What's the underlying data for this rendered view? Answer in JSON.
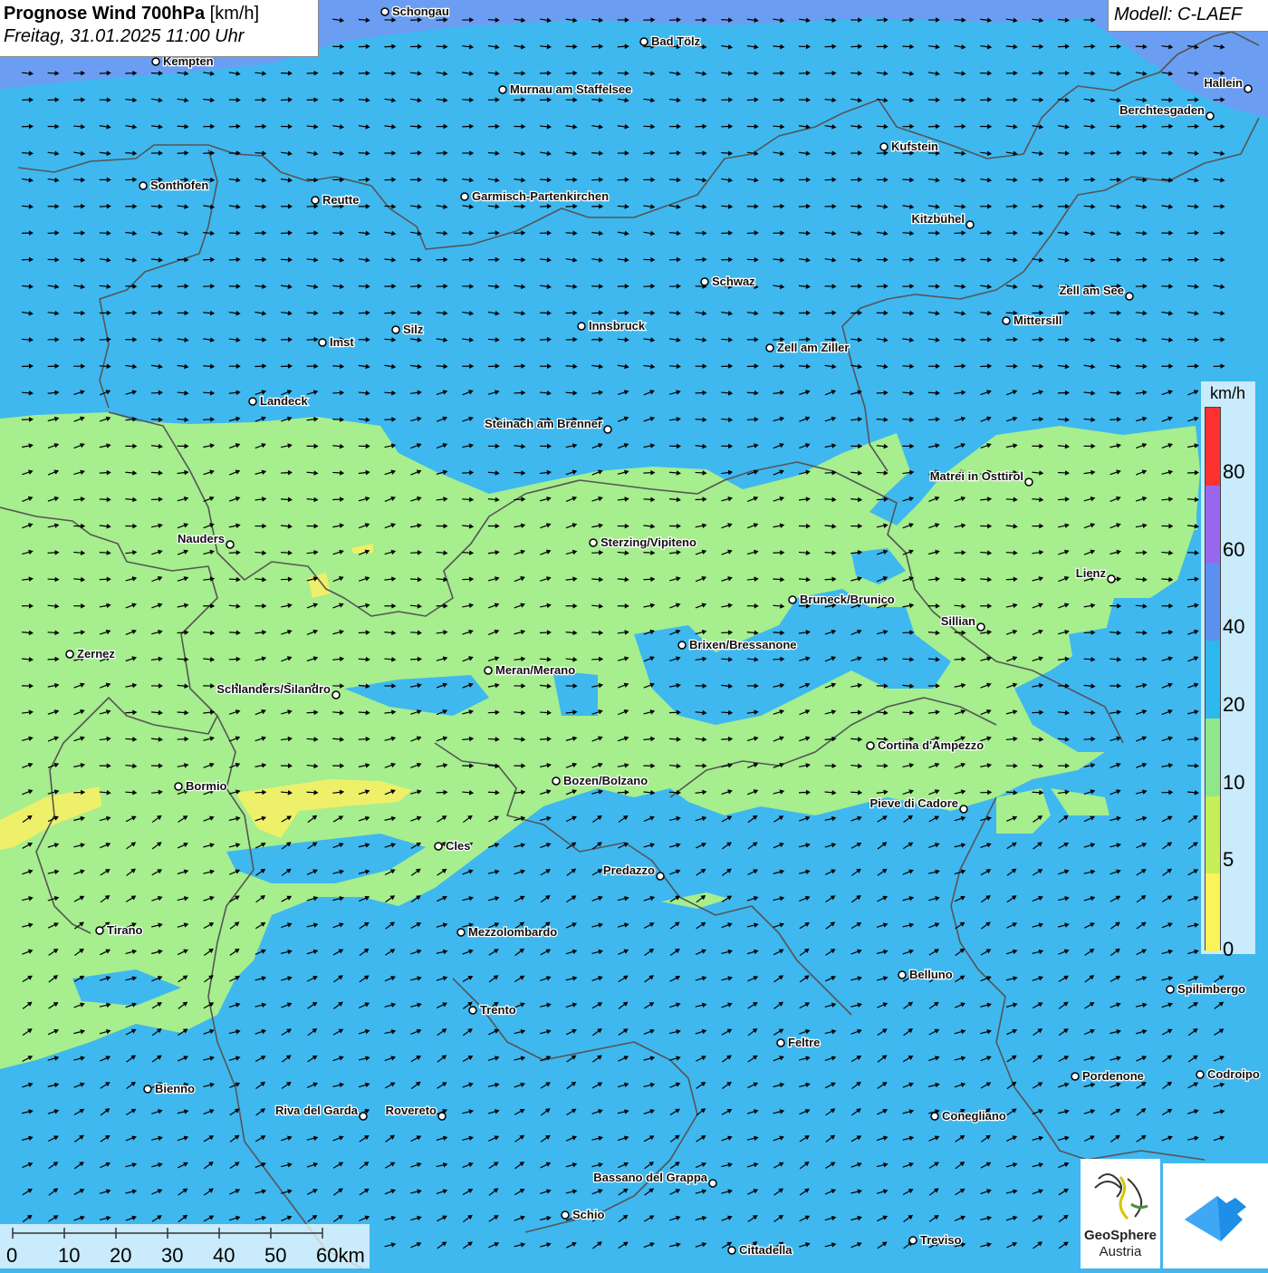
{
  "header": {
    "title_bold": "Prognose Wind 700hPa",
    "title_unit": "[km/h]",
    "datetime": "Freitag, 31.01.2025 11:00 Uhr"
  },
  "model_label": "Modell: C-LAEF",
  "legend": {
    "unit": "km/h",
    "labels": [
      "80",
      "60",
      "40",
      "20",
      "10",
      "5",
      "0"
    ],
    "colors": [
      "#ff3030",
      "#9966ee",
      "#5b8ff0",
      "#2db8ee",
      "#8ee88a",
      "#c6ef5a",
      "#fbf35a"
    ]
  },
  "scale": {
    "labels": [
      "0",
      "10",
      "20",
      "30",
      "40",
      "50",
      "60km"
    ]
  },
  "logos": {
    "geosphere_line1": "GeoSphere",
    "geosphere_line2": "Austria"
  },
  "colors": {
    "wind_5_10": "#a6ee8e",
    "wind_10_20": "#3fb8ef",
    "wind_20_40": "#6b9ef2",
    "wind_0_5": "#eef06a",
    "borders": "#555555",
    "arrows": "#000000"
  },
  "cities": [
    {
      "name": "Schongau"
    },
    {
      "name": "Bad Tölz"
    },
    {
      "name": "Kempten"
    },
    {
      "name": "Murnau am Staffelsee"
    },
    {
      "name": "Hallein"
    },
    {
      "name": "Berchtesgaden"
    },
    {
      "name": "Kufstein"
    },
    {
      "name": "Sonthofen"
    },
    {
      "name": "Reutte"
    },
    {
      "name": "Garmisch-Partenkirchen"
    },
    {
      "name": "Kitzbühel"
    },
    {
      "name": "Schwaz"
    },
    {
      "name": "Zell am See"
    },
    {
      "name": "Mittersill"
    },
    {
      "name": "Imst"
    },
    {
      "name": "Silz"
    },
    {
      "name": "Innsbruck"
    },
    {
      "name": "Zell am Ziller"
    },
    {
      "name": "Landeck"
    },
    {
      "name": "Steinach am Brenner"
    },
    {
      "name": "Matrei in Osttirol"
    },
    {
      "name": "Nauders"
    },
    {
      "name": "Sterzing/Vipiteno"
    },
    {
      "name": "Lienz"
    },
    {
      "name": "Bruneck/Brunico"
    },
    {
      "name": "Sillian"
    },
    {
      "name": "Brixen/Bressanone"
    },
    {
      "name": "Zernez"
    },
    {
      "name": "Meran/Merano"
    },
    {
      "name": "Schlanders/Silandro"
    },
    {
      "name": "Cortina d'Ampezzo"
    },
    {
      "name": "Bormio"
    },
    {
      "name": "Bozen/Bolzano"
    },
    {
      "name": "Pieve di Cadore"
    },
    {
      "name": "Cles"
    },
    {
      "name": "Predazzo"
    },
    {
      "name": "Tirano"
    },
    {
      "name": "Mezzolombardo"
    },
    {
      "name": "Belluno"
    },
    {
      "name": "Spilimbergo"
    },
    {
      "name": "Trento"
    },
    {
      "name": "Feltre"
    },
    {
      "name": "Pordenone"
    },
    {
      "name": "Codroipo"
    },
    {
      "name": "Bienno"
    },
    {
      "name": "Riva del Garda"
    },
    {
      "name": "Rovereto"
    },
    {
      "name": "Conegliano"
    },
    {
      "name": "Bassano del Grappa"
    },
    {
      "name": "Schio"
    },
    {
      "name": "Treviso"
    },
    {
      "name": "Cittadella"
    }
  ]
}
